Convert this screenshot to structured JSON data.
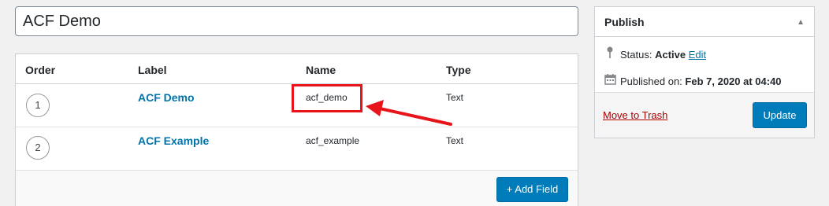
{
  "post": {
    "title": "ACF Demo"
  },
  "fields": {
    "headers": {
      "order": "Order",
      "label": "Label",
      "name": "Name",
      "type": "Type"
    },
    "rows": [
      {
        "order": "1",
        "label": "ACF Demo",
        "name": "acf_demo",
        "type": "Text"
      },
      {
        "order": "2",
        "label": "ACF Example",
        "name": "acf_example",
        "type": "Text"
      }
    ],
    "add_button": "+ Add Field"
  },
  "publish": {
    "title": "Publish",
    "toggle_icon": "triangle-up-icon",
    "status_label": "Status: ",
    "status_value": "Active",
    "edit_label": "Edit",
    "published_label": "Published on: ",
    "published_value": "Feb 7, 2020 at 04:40",
    "trash_label": "Move to Trash",
    "update_label": "Update"
  },
  "colors": {
    "accent": "#007cba",
    "link": "#0073aa",
    "highlight": "#e8141b",
    "trash": "#aa0000"
  }
}
